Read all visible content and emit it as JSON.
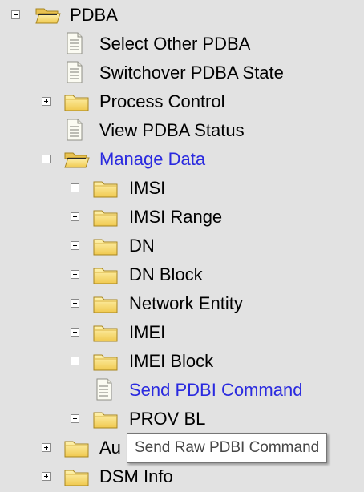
{
  "tree": {
    "root": {
      "label": "PDBA",
      "state": "expanded"
    },
    "items": [
      {
        "label": "Select Other PDBA",
        "kind": "page"
      },
      {
        "label": "Switchover PDBA State",
        "kind": "page"
      },
      {
        "label": "Process Control",
        "kind": "folder",
        "state": "collapsed"
      },
      {
        "label": "View PDBA Status",
        "kind": "page"
      },
      {
        "label": "Manage Data",
        "kind": "folder",
        "state": "expanded",
        "highlighted": true
      },
      {
        "label": "IMSI",
        "kind": "folder",
        "state": "collapsed"
      },
      {
        "label": "IMSI Range",
        "kind": "folder",
        "state": "collapsed"
      },
      {
        "label": "DN",
        "kind": "folder",
        "state": "collapsed"
      },
      {
        "label": "DN Block",
        "kind": "folder",
        "state": "collapsed"
      },
      {
        "label": "Network Entity",
        "kind": "folder",
        "state": "collapsed"
      },
      {
        "label": "IMEI",
        "kind": "folder",
        "state": "collapsed"
      },
      {
        "label": "IMEI Block",
        "kind": "folder",
        "state": "collapsed"
      },
      {
        "label": "Send PDBI Command",
        "kind": "page",
        "highlighted": true
      },
      {
        "label": "PROV BL",
        "kind": "folder",
        "state": "collapsed"
      },
      {
        "label": "Au",
        "kind": "folder",
        "state": "collapsed"
      },
      {
        "label": "DSM Info",
        "kind": "folder",
        "state": "collapsed"
      }
    ]
  },
  "tooltip": {
    "text": "Send Raw PDBI Command"
  },
  "colors": {
    "background": "#e2e2e2",
    "link_text": "#2a2adf",
    "folder_fill": "#f6d774",
    "folder_edge": "#b3932d"
  },
  "icons": {
    "folder": "folder-icon",
    "open_folder": "open-folder-icon",
    "page": "document-icon",
    "expand": "plus-box-icon",
    "collapse": "minus-box-icon"
  }
}
